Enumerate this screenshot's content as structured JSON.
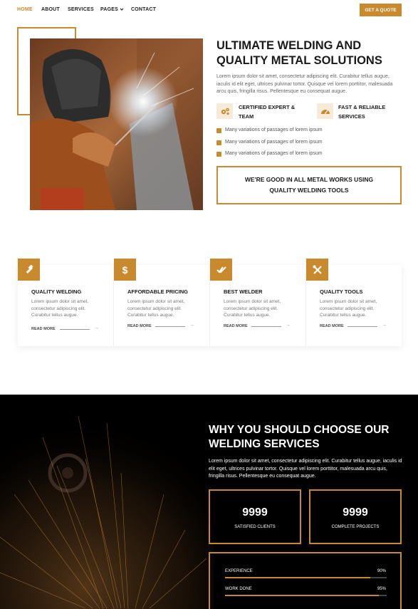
{
  "nav": {
    "items": [
      "HOME",
      "ABOUT",
      "SERVICES",
      "PAGES",
      "CONTACT"
    ],
    "quote_label": "GET A QUOTE"
  },
  "hero": {
    "title": "ULTIMATE WELDING AND QUALITY METAL SOLUTIONS",
    "paragraph": "Lorem ipsum dolor sit amet, consectetur adipiscing elit. Curabitur tellus augue, iaculis id elit eget, ultrices pulvinar tortor. Quisque vel lorem porttitor, malesuada arcu quis, fringilla risus. Pellentesque eu consequat augue.",
    "features": [
      {
        "label_line1": "CERTIFIED EXPERT &",
        "label_line2": "TEAM",
        "icon": "gears-icon"
      },
      {
        "label_line1": "FAST & RELIABLE",
        "label_line2": "SERVICES",
        "icon": "speedometer-icon"
      }
    ],
    "checklist": [
      "Many variations of passages of lorem ipsum",
      "Many variations of passages of lorem ipsum",
      "Many variations of passages of lorem ipsum"
    ],
    "box_line1": "WE'RE GOOD IN ALL METAL WORKS USING",
    "box_line2": "QUALITY WELDING TOOLS"
  },
  "services": [
    {
      "title": "QUALITY WELDING",
      "text": "Lorem ipsum dolor sit amet, consectetur adipiscing elit. Curabitur tellus augue.",
      "more": "READ MORE",
      "icon": "hammer-icon"
    },
    {
      "title": "AFFORDABLE PRICING",
      "text": "Lorem ipsum dolor sit amet, consectetur adipiscing elit. Curabitur tellus augue.",
      "more": "READ MORE",
      "icon": "dollar-icon"
    },
    {
      "title": "BEST WELDER",
      "text": "Lorem ipsum dolor sit amet, consectetur adipiscing elit. Curabitur tellus augue.",
      "more": "READ MORE",
      "icon": "double-check-icon"
    },
    {
      "title": "QUALITY TOOLS",
      "text": "Lorem ipsum dolor sit amet, consectetur adipiscing elit. Curabitur tellus augue.",
      "more": "READ MORE",
      "icon": "tools-icon"
    }
  ],
  "why": {
    "title": "WHY YOU SHOULD CHOOSE OUR WELDING SERVICES",
    "paragraph": "Lorem ipsum dolor sit amet, consectetur adipiscing elit. Curabitur tellus augue, iaculis id elit eget, ultrices pulvinar tortor. Quisque vel lorem porttitor, malesuada arcu quis, fringilla risus. Pellentesque eu consequat augue.",
    "stats": [
      {
        "number": "9999",
        "label": "SATISFIED CLIENTS"
      },
      {
        "number": "9999",
        "label": "COMPLETE PROJECTS"
      }
    ],
    "skills": [
      {
        "label": "EXPERIENCE",
        "percent": "90%",
        "value": 0.9
      },
      {
        "label": "WORK DONE",
        "percent": "95%",
        "value": 0.95
      }
    ]
  },
  "colors": {
    "accent": "#c98a2e",
    "dark": "#000000",
    "text": "#1a1a1a"
  }
}
